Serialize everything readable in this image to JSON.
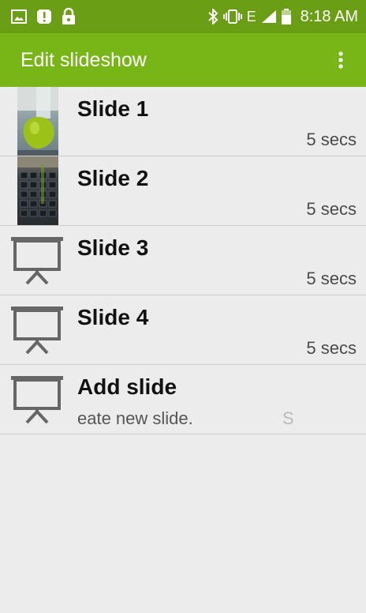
{
  "status_bar": {
    "time": "8:18 AM",
    "network": "E",
    "left_icons": [
      "gallery-icon",
      "alert-icon",
      "lock-icon"
    ],
    "right_icons": [
      "bluetooth-icon",
      "vibrate-icon",
      "signal-icon",
      "battery-icon"
    ]
  },
  "app_bar": {
    "title": "Edit slideshow",
    "overflow_icon": "more-vert-icon"
  },
  "slides": [
    {
      "title": "Slide 1",
      "duration": "5 secs",
      "thumb": "photo-vase"
    },
    {
      "title": "Slide 2",
      "duration": "5 secs",
      "thumb": "photo-keyboard"
    },
    {
      "title": "Slide 3",
      "duration": "5 secs",
      "thumb": "projector-screen-icon"
    },
    {
      "title": "Slide 4",
      "duration": "5 secs",
      "thumb": "projector-screen-icon"
    }
  ],
  "add_slide": {
    "title": "Add slide",
    "subtitle": "eate new slide.",
    "trailing": "S",
    "icon": "projector-screen-icon"
  },
  "colors": {
    "status_bar": "#6a9e14",
    "app_bar": "#78b516",
    "background": "#ececec"
  }
}
